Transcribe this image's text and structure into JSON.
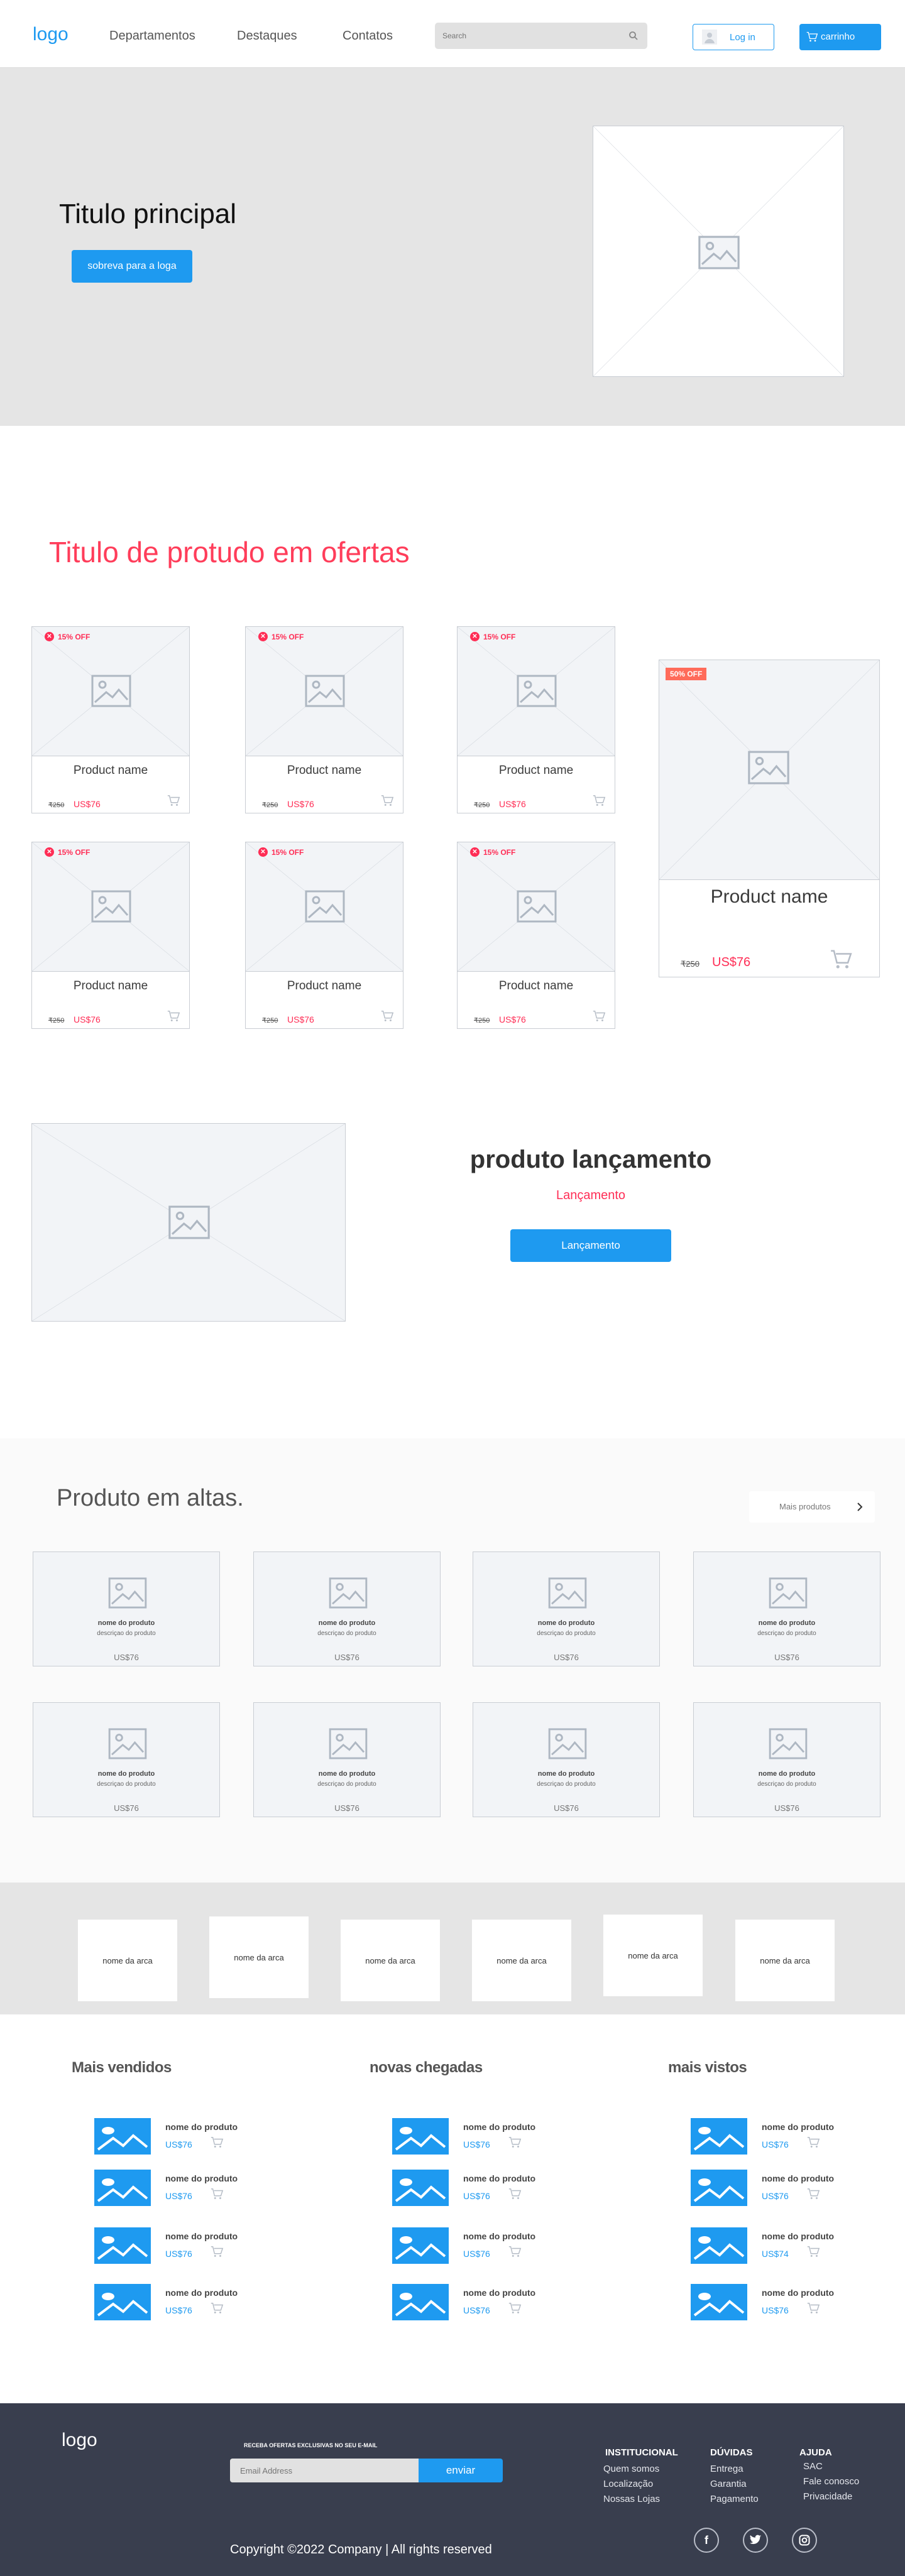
{
  "header": {
    "logo": "logo",
    "nav": [
      "Departamentos",
      "Destaques",
      "Contatos"
    ],
    "search_placeholder": "Search",
    "login": "Log in",
    "cart": "carrinho"
  },
  "hero": {
    "title": "Titulo principal",
    "button": "sobreva para a loga"
  },
  "offers": {
    "title": "Titulo de protudo em ofertas",
    "badge": "15% OFF",
    "name": "Product name",
    "old_price": "₹250",
    "new_price": "US$76",
    "featured_badge": "50% OFF",
    "featured_name": "Product name",
    "featured_old_price": "₹250",
    "featured_new_price": "US$76"
  },
  "launch": {
    "title": "produto lançamento",
    "subtitle": "Lançamento",
    "button": "Lançamento"
  },
  "trending": {
    "title": "Produto em altas.",
    "more": "Mais produtos",
    "name": "nome do produto",
    "desc": "descriçao do produto",
    "price": "US$76"
  },
  "brands": {
    "label": "nome da arca"
  },
  "lists": {
    "mais_vendidos": "Mais vendidos",
    "novas_chegadas": "novas chegadas",
    "mais_vistos": "mais vistos",
    "name": "nome do produto",
    "prices": [
      "US$76",
      "US$76",
      "US$76",
      "US$76"
    ],
    "third_prices": [
      "US$76",
      "US$76",
      "US$74",
      "US$76"
    ]
  },
  "footer": {
    "logo": "logo",
    "newsletter_label": "RECEBA OFERTAS EXCLUSIVAS NO SEU E-MAIL",
    "email_placeholder": "Email Address",
    "send": "enviar",
    "col1_title": "INSTITUCIONAL",
    "col1": [
      "Quem somos",
      "Localização",
      "Nossas Lojas"
    ],
    "col2_title": "DÚVIDAS",
    "col2": [
      "Entrega",
      "Garantia",
      "Pagamento"
    ],
    "col3_title": "AJUDA",
    "col3": [
      "SAC",
      "Fale conosco",
      "Privacidade"
    ],
    "copyright": "Copyright ©2022 Company | All rights reserved",
    "social": [
      "facebook-icon",
      "twitter-icon",
      "instagram-icon"
    ]
  }
}
